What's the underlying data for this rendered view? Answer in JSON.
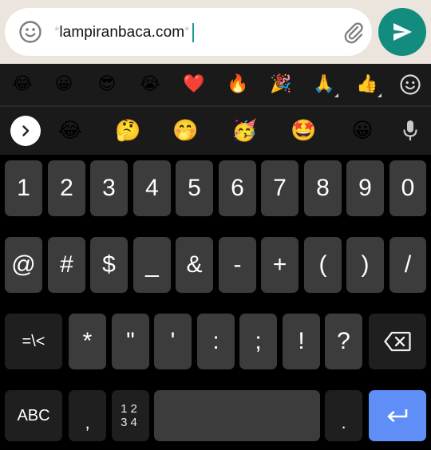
{
  "compose": {
    "prefix_star": "*",
    "text": "lampiranbaca.com",
    "suffix_star": "*",
    "icons": {
      "emoji": "emoji-smiley-icon",
      "attach": "paperclip-icon",
      "send": "send-arrow-icon"
    },
    "colors": {
      "send_bg": "#128c7e",
      "caret": "#1e9c8b"
    }
  },
  "emoji_recent": [
    "😂",
    "😀",
    "😎",
    "😭",
    "❤️",
    "🔥",
    "🎉",
    "🙏",
    "👍"
  ],
  "emoji_recent_tab_icon": "smiley-outline-icon",
  "emoji_suggestions": [
    "😂",
    "🤔",
    "🤭",
    "🥳",
    "🤩",
    "😀"
  ],
  "emoji_suggestion_icons": {
    "expand": "chevron-right-icon",
    "mic": "microphone-icon"
  },
  "keyboard": {
    "row_numbers": [
      "1",
      "2",
      "3",
      "4",
      "5",
      "6",
      "7",
      "8",
      "9",
      "0"
    ],
    "row_symbols": [
      "@",
      "#",
      "$",
      "_",
      "&",
      "-",
      "+",
      "(",
      ")",
      "/"
    ],
    "row_more": [
      "*",
      "\"",
      "'",
      ":",
      ";",
      "!",
      "?"
    ],
    "more_symbols_label": "=\\<",
    "abc_label": "ABC",
    "comma_label": ",",
    "numpad_label_top": "12",
    "numpad_label_bottom": "34",
    "period_label": ".",
    "backspace_icon": "backspace-icon",
    "enter_icon": "enter-return-icon",
    "colors": {
      "key": "#3c3c3c",
      "key_dark": "#1f1f1f",
      "enter": "#5f8ff6"
    }
  }
}
